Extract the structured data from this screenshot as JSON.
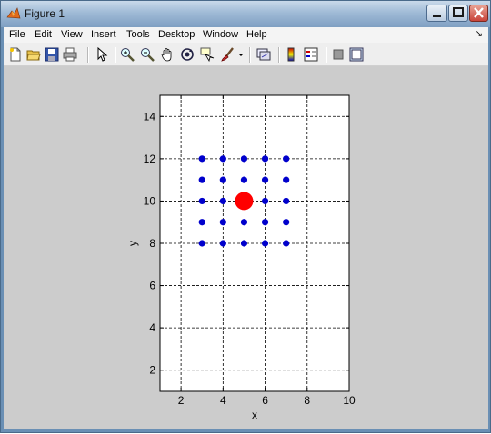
{
  "window": {
    "title": "Figure 1"
  },
  "menu": {
    "items": [
      {
        "key": "file",
        "label": "File"
      },
      {
        "key": "edit",
        "label": "Edit"
      },
      {
        "key": "view",
        "label": "View"
      },
      {
        "key": "insert",
        "label": "Insert"
      },
      {
        "key": "tools",
        "label": "Tools"
      },
      {
        "key": "desktop",
        "label": "Desktop"
      },
      {
        "key": "window",
        "label": "Window"
      },
      {
        "key": "help",
        "label": "Help"
      }
    ],
    "dock_arrow": "↘"
  },
  "toolbar": {
    "buttons": [
      "new-figure-icon",
      "open-file-icon",
      "save-icon",
      "print-icon",
      "edit-plot-arrow-icon",
      "zoom-in-icon",
      "zoom-out-icon",
      "pan-hand-icon",
      "rotate-3d-icon",
      "data-cursor-icon",
      "brush-icon",
      "brush-dropdown-icon",
      "link-plot-icon",
      "colorbar-icon",
      "legend-icon",
      "hide-plot-tools-icon",
      "show-plot-tools-icon"
    ]
  },
  "colors": {
    "grid_dots": "#0000cc",
    "center_dot": "#ff0000",
    "figure_bg": "#cccccc"
  },
  "chart_data": {
    "type": "scatter",
    "xlabel": "x",
    "ylabel": "y",
    "xlim": [
      1,
      10
    ],
    "ylim": [
      1,
      15
    ],
    "xticks": [
      2,
      4,
      6,
      8,
      10
    ],
    "yticks": [
      2,
      4,
      6,
      8,
      10,
      12,
      14
    ],
    "grid": true,
    "grid_style": "dashed",
    "series": [
      {
        "marker": "dot",
        "color": "#0000cc",
        "x": [
          3,
          4,
          5,
          6,
          7,
          3,
          4,
          5,
          6,
          7,
          3,
          4,
          6,
          7,
          3,
          4,
          5,
          6,
          7,
          3,
          4,
          5,
          6,
          7
        ],
        "y": [
          12,
          12,
          12,
          12,
          12,
          11,
          11,
          11,
          11,
          11,
          10,
          10,
          10,
          10,
          9,
          9,
          9,
          9,
          9,
          8,
          8,
          8,
          8,
          8
        ]
      },
      {
        "marker": "large-dot",
        "color": "#ff0000",
        "x": [
          5
        ],
        "y": [
          10
        ]
      }
    ]
  }
}
